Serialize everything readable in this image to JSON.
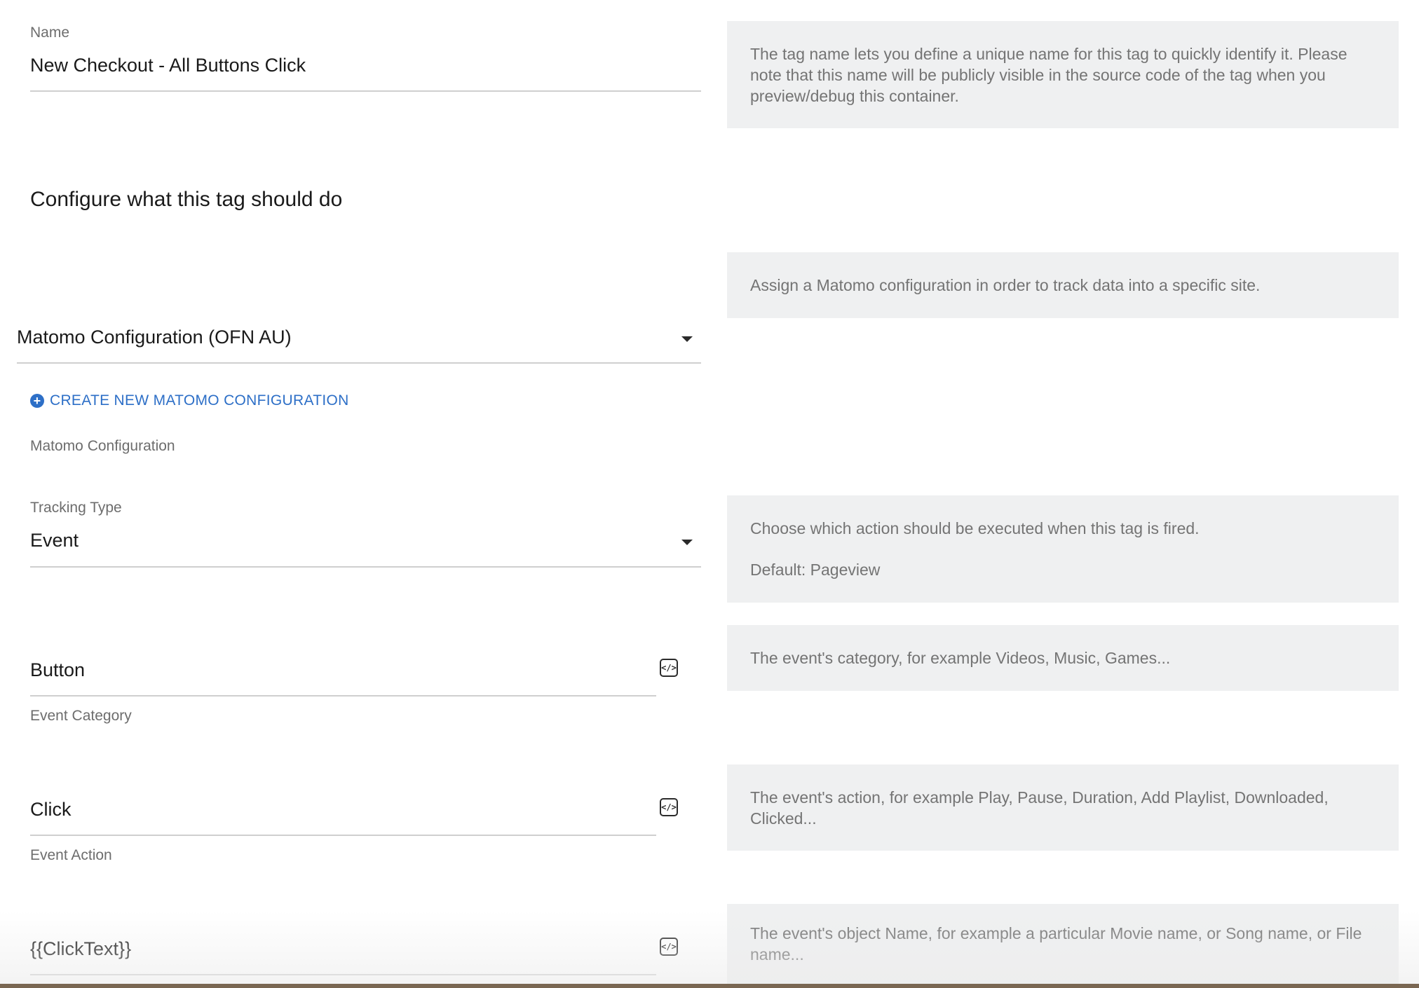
{
  "name_field": {
    "label": "Name",
    "value": "New Checkout - All Buttons Click",
    "help": "The tag name lets you define a unique name for this tag to quickly identify it. Please note that this name will be publicly visible in the source code of the tag when you preview/debug this container."
  },
  "section": {
    "title": "Configure what this tag should do"
  },
  "matomo_config": {
    "selected": "Matomo Configuration (OFN AU)",
    "help": "Assign a Matomo configuration in order to track data into a specific site.",
    "create_link": "CREATE NEW MATOMO CONFIGURATION",
    "label": "Matomo Configuration",
    "icon": "plus-circle-icon"
  },
  "tracking_type": {
    "label": "Tracking Type",
    "selected": "Event",
    "help": "Choose which action should be executed when this tag is fired.",
    "help_default": "Default: Pageview"
  },
  "event_category": {
    "value": "Button",
    "label": "Event Category",
    "help": "The event's category, for example Videos, Music, Games..."
  },
  "event_action": {
    "value": "Click",
    "label": "Event Action",
    "help": "The event's action, for example Play, Pause, Duration, Add Playlist, Downloaded, Clicked..."
  },
  "event_name": {
    "value": "{{ClickText}}",
    "help": "The event's object Name, for example a particular Movie name, or Song name, or File name..."
  },
  "icons": {
    "variable_selector": "variable-selector-icon",
    "dropdown": "chevron-down-icon"
  },
  "colors": {
    "link": "#2d6fc7",
    "help_bg": "#eff0f1",
    "underline": "#cfcfcf"
  }
}
